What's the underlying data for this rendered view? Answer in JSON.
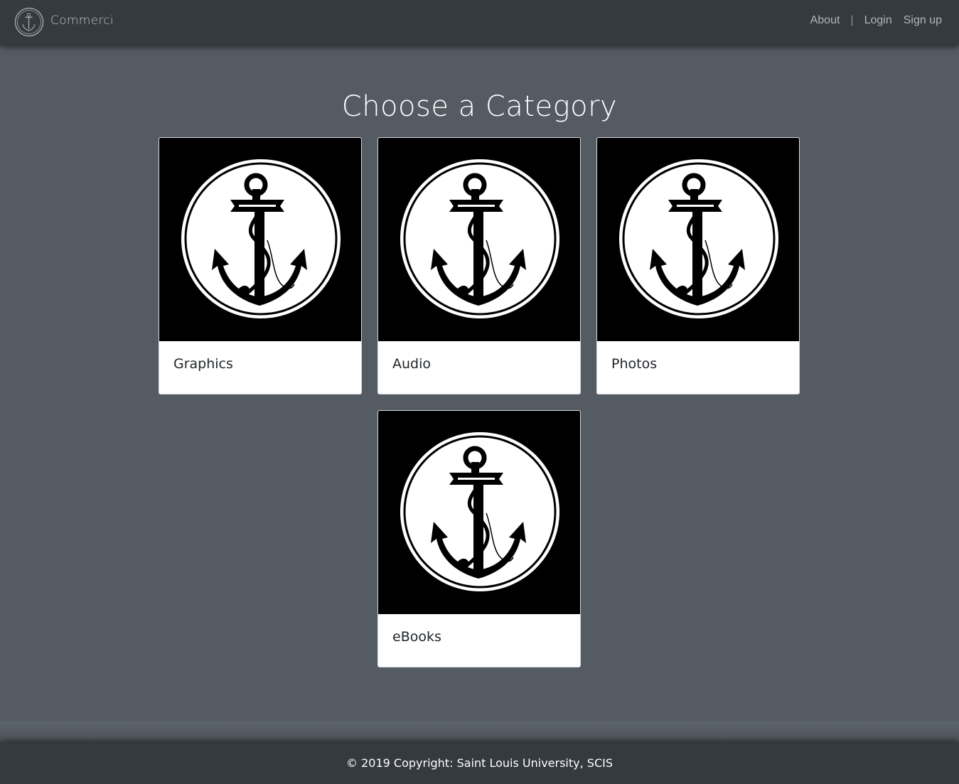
{
  "navbar": {
    "brand": "Commerci",
    "links": {
      "about": "About",
      "separator": "|",
      "login": "Login",
      "signup": "Sign up"
    }
  },
  "main": {
    "title": "Choose a Category",
    "categories": [
      {
        "label": "Graphics",
        "icon": "anchor-icon"
      },
      {
        "label": "Audio",
        "icon": "anchor-icon"
      },
      {
        "label": "Photos",
        "icon": "anchor-icon"
      },
      {
        "label": "eBooks",
        "icon": "anchor-icon"
      }
    ]
  },
  "footer": {
    "copyright": "© 2019 Copyright: Saint Louis University, SCIS"
  },
  "colors": {
    "navbar": "#343a40",
    "page_background": "#545b63",
    "card_background": "#ffffff",
    "card_image_background": "#000000"
  }
}
